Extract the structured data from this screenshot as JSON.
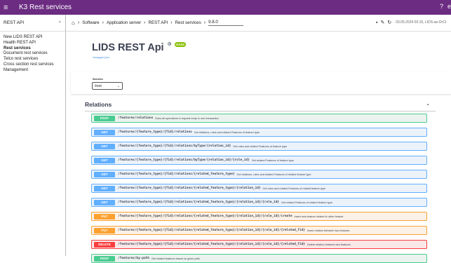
{
  "topbar": {
    "title": "K3  Rest services",
    "help_icon": "?",
    "user_icon": "e"
  },
  "sidebar": {
    "header": "REST API",
    "items": [
      {
        "label": "New LIDS REST API",
        "active": false
      },
      {
        "label": "Health REST API",
        "active": false
      },
      {
        "label": "Rest services",
        "active": true
      },
      {
        "label": "Document rest services",
        "active": false
      },
      {
        "label": "Telco rest services",
        "active": false
      },
      {
        "label": "Cross section rest services",
        "active": false
      },
      {
        "label": "Management",
        "active": false
      }
    ]
  },
  "breadcrumb": {
    "items": [
      "Software",
      "Application server",
      "REST API",
      "Rest services"
    ],
    "current": "9.8.0"
  },
  "toolbar": {
    "timestamp": "03.05.2024 03:15, LIDS-as-OrCt"
  },
  "swagger": {
    "title": "LIDS REST Api",
    "version_badge": "0",
    "oas_badge": "OAS3",
    "link": "/swagger.json",
    "servers_label": "Servers",
    "server_value": "/rest",
    "tag": "Relations",
    "operations": [
      {
        "method": "POST",
        "path": "/features/relations",
        "summary": "Does all operations in request body in one transaction"
      },
      {
        "method": "GET",
        "path": "/features/{feature_type}/{fid}/relations",
        "summary": "Get relations, roles and related Features of feature type"
      },
      {
        "method": "GET",
        "path": "/features/{feature_type}/{fid}/relations/byType/{relation_id}",
        "summary": "Get roles and related Features of feature type"
      },
      {
        "method": "GET",
        "path": "/features/{feature_type}/{fid}/relations/byType/{relation_id}/{role_id}",
        "summary": "Get related Features of feature type"
      },
      {
        "method": "GET",
        "path": "/features/{feature_type}/{fid}/relations/{related_feature_type}",
        "summary": "Get relations, roles and related Features of related feature type"
      },
      {
        "method": "GET",
        "path": "/features/{feature_type}/{fid}/relations/{related_feature_type}/{relation_id}",
        "summary": "Get roles and related Features of related feature type"
      },
      {
        "method": "GET",
        "path": "/features/{feature_type}/{fid}/relations/{related_feature_type}/{relation_id}/{role_id}",
        "summary": "Get related Features of related feature type"
      },
      {
        "method": "PUT",
        "path": "/features/{feature_type}/{fid}/relations/{related_feature_type}/{relation_id}/{role_id}/create",
        "summary": "Insert new feature related to other feature."
      },
      {
        "method": "PUT",
        "path": "/features/{feature_type}/{fid}/relations/{related_feature_type}/{relation_id}/{role_id}/{related_fid}",
        "summary": "Insert relation between two features."
      },
      {
        "method": "DELETE",
        "path": "/features/{feature_type}/{fid}/relations/{related_feature_type}/{relation_id}/{role_id}/{related_fid}",
        "summary": "Delete relation between two features."
      },
      {
        "method": "POST",
        "path": "/features/by-path",
        "summary": "Get related features based on given path"
      }
    ]
  }
}
